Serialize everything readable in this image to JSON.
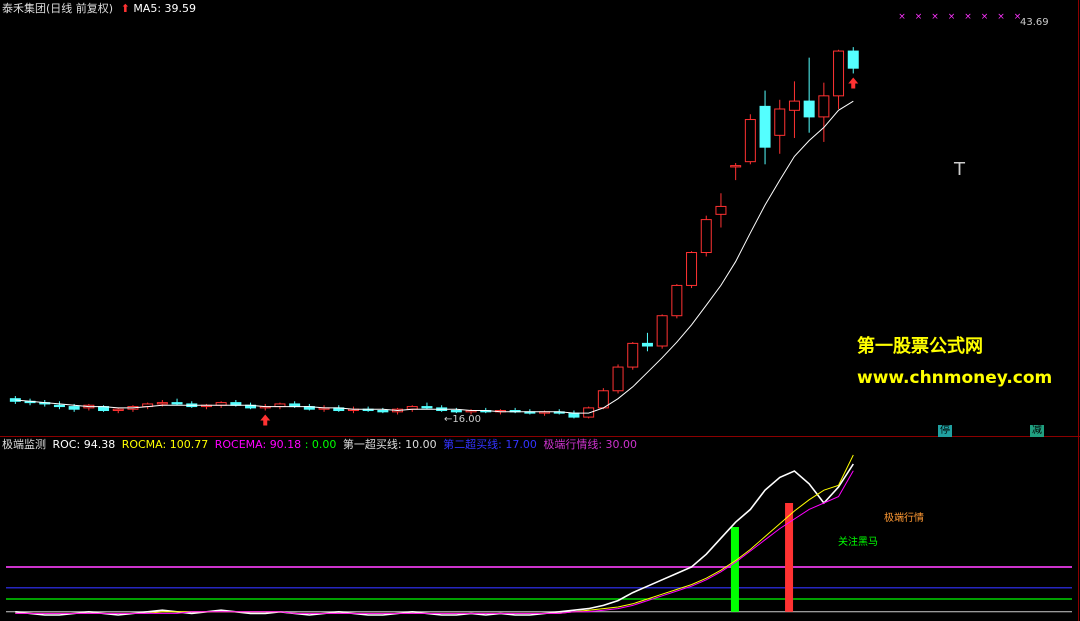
{
  "main_panel": {
    "title": "泰禾集团(日线 前复权)",
    "ma_label": "MA5:",
    "ma_value": "39.59",
    "high_label": "43.69",
    "low_label": "←16.00",
    "marker_t": "T",
    "tag_left": "停",
    "tag_right": "减"
  },
  "indicator_panel": {
    "name": "极端监测",
    "roc_label": "ROC:",
    "roc_value": "94.38",
    "rocma_label": "ROCMA:",
    "rocma_value": "100.77",
    "rocema_label": "ROCEMA:",
    "rocema_value": "90.18",
    "zero_value": ": 0.00",
    "line1_label": "第一超买线:",
    "line1_value": "10.00",
    "line2_label": "第二超买线:",
    "line2_value": "17.00",
    "line3_label": "极端行情线:",
    "line3_value": "30.00",
    "bar_green_text": "关注黑马",
    "bar_red_text": "极端行情"
  },
  "watermark": {
    "title": "第一股票公式网",
    "url": "www.chnmoney.com"
  },
  "colors": {
    "background": "#000000",
    "up": "#ff3232",
    "down": "#54ffff",
    "ma": "#ffffff",
    "roc": "#ffffff",
    "rocma": "#ffff00",
    "rocema": "#ff00ff",
    "line1": "#00ff00",
    "line2": "#3333ff",
    "line3": "#cc33cc",
    "divider": "#8b0000",
    "watermark_title": "#ffff00",
    "watermark_url": "#ffff00"
  },
  "chart_data": [
    {
      "type": "candlestick",
      "title": "泰禾集团(日线 前复权)",
      "series_overlay": "MA5",
      "annotations": [
        "43.69",
        "16.00"
      ],
      "candles": [
        [
          17.0,
          17.2,
          16.6,
          16.8
        ],
        [
          16.8,
          17.0,
          16.5,
          16.7
        ],
        [
          16.7,
          16.9,
          16.4,
          16.6
        ],
        [
          16.5,
          16.8,
          16.2,
          16.4
        ],
        [
          16.4,
          16.6,
          16.0,
          16.2
        ],
        [
          16.3,
          16.6,
          16.1,
          16.5
        ],
        [
          16.4,
          16.5,
          16.0,
          16.1
        ],
        [
          16.1,
          16.3,
          15.9,
          16.2
        ],
        [
          16.2,
          16.5,
          16.0,
          16.4
        ],
        [
          16.4,
          16.7,
          16.2,
          16.6
        ],
        [
          16.6,
          16.9,
          16.4,
          16.7
        ],
        [
          16.7,
          17.0,
          16.5,
          16.6
        ],
        [
          16.6,
          16.8,
          16.3,
          16.4
        ],
        [
          16.4,
          16.6,
          16.2,
          16.5
        ],
        [
          16.5,
          16.8,
          16.3,
          16.7
        ],
        [
          16.7,
          16.9,
          16.4,
          16.5
        ],
        [
          16.5,
          16.7,
          16.2,
          16.3
        ],
        [
          16.3,
          16.6,
          16.1,
          16.4
        ],
        [
          16.4,
          16.7,
          16.2,
          16.6
        ],
        [
          16.6,
          16.8,
          16.3,
          16.4
        ],
        [
          16.4,
          16.6,
          16.1,
          16.2
        ],
        [
          16.2,
          16.5,
          16.0,
          16.3
        ],
        [
          16.3,
          16.5,
          16.0,
          16.1
        ],
        [
          16.1,
          16.4,
          15.9,
          16.2
        ],
        [
          16.2,
          16.4,
          16.0,
          16.1
        ],
        [
          16.1,
          16.3,
          15.9,
          16.0
        ],
        [
          16.0,
          16.3,
          15.8,
          16.2
        ],
        [
          16.2,
          16.5,
          16.0,
          16.4
        ],
        [
          16.4,
          16.7,
          16.2,
          16.3
        ],
        [
          16.3,
          16.5,
          16.0,
          16.1
        ],
        [
          16.1,
          16.3,
          15.9,
          16.0
        ],
        [
          16.0,
          16.2,
          15.8,
          16.1
        ],
        [
          16.1,
          16.3,
          15.9,
          16.0
        ],
        [
          16.0,
          16.2,
          15.8,
          16.1
        ],
        [
          16.1,
          16.3,
          15.9,
          16.0
        ],
        [
          16.0,
          16.2,
          15.8,
          15.9
        ],
        [
          15.9,
          16.1,
          15.7,
          16.0
        ],
        [
          16.0,
          16.2,
          15.8,
          15.9
        ],
        [
          15.9,
          16.1,
          15.5,
          15.6
        ],
        [
          15.6,
          16.4,
          15.5,
          16.3
        ],
        [
          16.3,
          17.8,
          16.2,
          17.6
        ],
        [
          17.6,
          19.6,
          17.4,
          19.4
        ],
        [
          19.4,
          21.3,
          19.2,
          21.2
        ],
        [
          21.2,
          22.0,
          20.6,
          21.0
        ],
        [
          21.0,
          23.4,
          20.8,
          23.3
        ],
        [
          23.3,
          25.7,
          23.1,
          25.6
        ],
        [
          25.6,
          28.2,
          25.4,
          28.1
        ],
        [
          28.1,
          30.9,
          27.8,
          30.6
        ],
        [
          31.0,
          32.6,
          30.0,
          31.6
        ],
        [
          34.6,
          34.9,
          33.6,
          34.7
        ],
        [
          35.0,
          38.6,
          34.8,
          38.2
        ],
        [
          39.2,
          40.4,
          34.8,
          36.1
        ],
        [
          37.0,
          39.7,
          35.6,
          39.0
        ],
        [
          38.9,
          41.1,
          36.8,
          39.6
        ],
        [
          39.6,
          42.9,
          37.2,
          38.4
        ],
        [
          38.4,
          41.0,
          36.5,
          40.0
        ],
        [
          40.0,
          43.5,
          39.0,
          43.4
        ],
        [
          43.4,
          43.7,
          41.7,
          42.1
        ]
      ],
      "ma5": [
        16.9,
        16.8,
        16.7,
        16.6,
        16.5,
        16.4,
        16.4,
        16.3,
        16.3,
        16.4,
        16.5,
        16.5,
        16.5,
        16.5,
        16.5,
        16.5,
        16.5,
        16.4,
        16.4,
        16.4,
        16.4,
        16.3,
        16.3,
        16.2,
        16.2,
        16.2,
        16.1,
        16.2,
        16.2,
        16.2,
        16.2,
        16.1,
        16.1,
        16.0,
        16.0,
        16.0,
        16.0,
        16.0,
        15.9,
        15.9,
        16.3,
        17.0,
        17.9,
        19.0,
        20.1,
        21.3,
        22.6,
        24.1,
        25.6,
        27.4,
        29.6,
        31.7,
        33.6,
        35.4,
        36.6,
        37.6,
        38.9,
        39.59
      ],
      "buy_arrows_at": [
        17,
        57
      ],
      "price_range": [
        15.0,
        45.0
      ]
    },
    {
      "type": "line",
      "title": "极端监测",
      "series": [
        {
          "name": "ROC",
          "values": [
            2,
            1,
            0,
            0,
            1,
            2,
            1,
            0,
            1,
            2,
            3,
            2,
            1,
            2,
            3,
            2,
            1,
            1,
            2,
            1,
            0,
            1,
            2,
            1,
            0,
            0,
            1,
            2,
            1,
            0,
            0,
            1,
            0,
            1,
            0,
            0,
            1,
            2,
            3,
            4,
            6,
            9,
            14,
            18,
            22,
            26,
            30,
            38,
            48,
            58,
            66,
            78,
            86,
            90,
            82,
            70,
            80,
            94.38
          ]
        },
        {
          "name": "ROCMA",
          "values": [
            1,
            1,
            1,
            1,
            1,
            1,
            1,
            1,
            1,
            1,
            2,
            2,
            2,
            2,
            2,
            2,
            2,
            2,
            2,
            1,
            1,
            1,
            1,
            1,
            1,
            1,
            1,
            1,
            1,
            1,
            1,
            1,
            1,
            1,
            1,
            1,
            1,
            1,
            2,
            3,
            4,
            5,
            7,
            10,
            13,
            16,
            19,
            23,
            28,
            34,
            41,
            49,
            57,
            65,
            72,
            78,
            81,
            100.77
          ]
        },
        {
          "name": "ROCEMA",
          "values": [
            1,
            1,
            1,
            1,
            1,
            1,
            1,
            1,
            1,
            1,
            1,
            1,
            2,
            2,
            2,
            2,
            2,
            2,
            2,
            1,
            1,
            1,
            1,
            1,
            1,
            1,
            1,
            1,
            1,
            1,
            1,
            1,
            1,
            1,
            1,
            1,
            1,
            1,
            2,
            2,
            3,
            4,
            6,
            9,
            12,
            15,
            18,
            22,
            27,
            33,
            40,
            47,
            54,
            60,
            66,
            70,
            74,
            90.18
          ]
        }
      ],
      "reference_lines": [
        {
          "name": "第一超买线",
          "value": 10
        },
        {
          "name": "第二超买线",
          "value": 17
        },
        {
          "name": "极端行情线",
          "value": 30
        }
      ],
      "signal_bars": [
        {
          "label": "关注黑马",
          "index": 48,
          "value": 55
        },
        {
          "label": "极端行情",
          "index": 51,
          "value": 70
        }
      ],
      "ylim": [
        0,
        100
      ]
    }
  ]
}
